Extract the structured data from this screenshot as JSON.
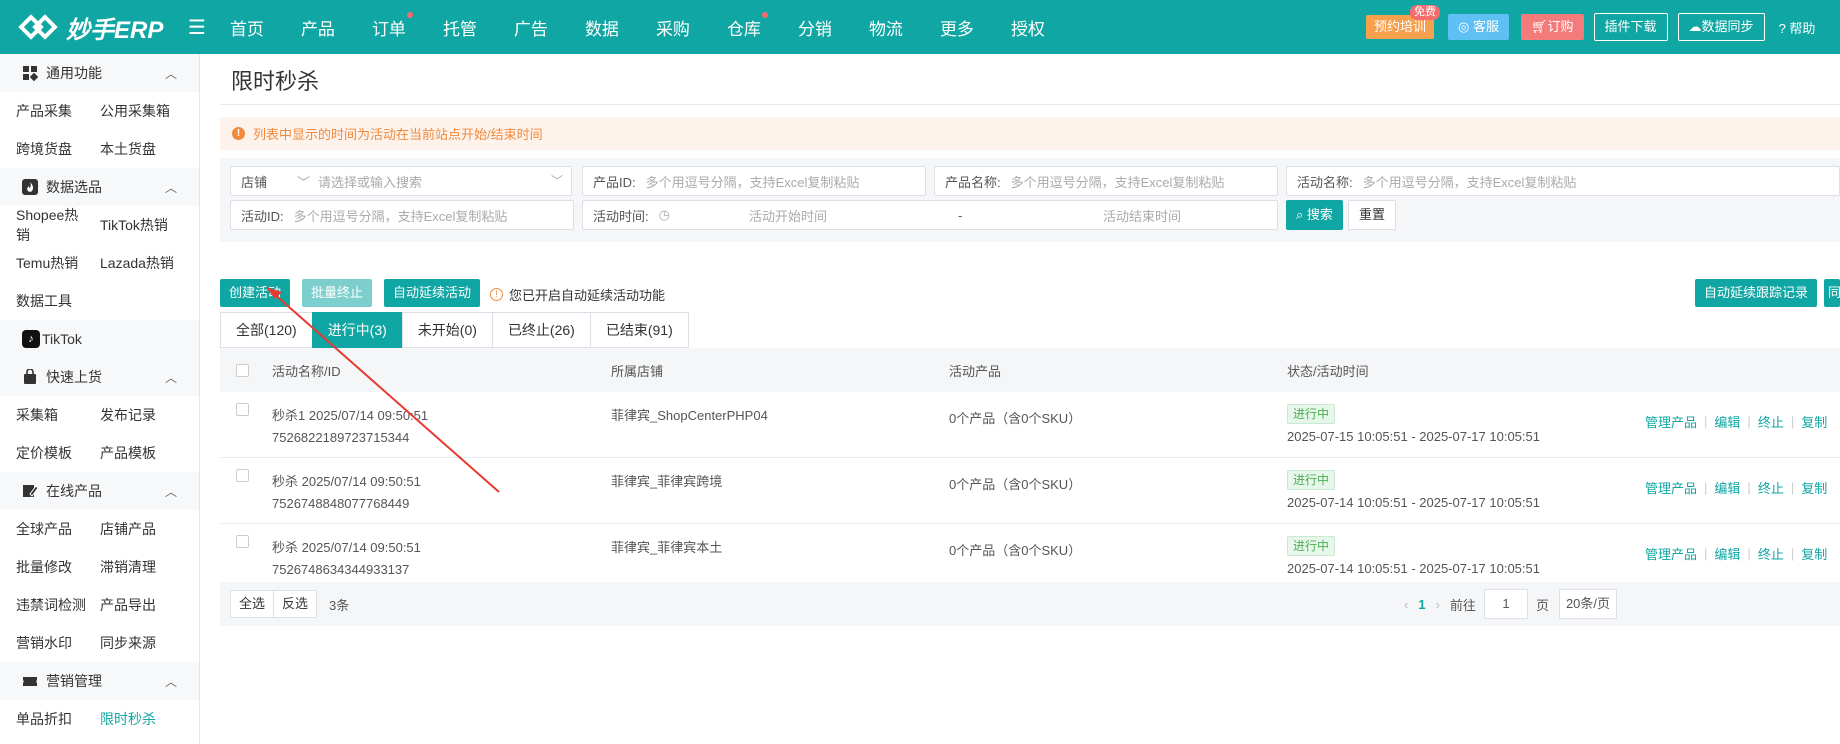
{
  "app": {
    "logo_text": "妙手ERP"
  },
  "top_nav": [
    {
      "label": "首页",
      "dot": false
    },
    {
      "label": "产品",
      "dot": false
    },
    {
      "label": "订单",
      "dot": true
    },
    {
      "label": "托管",
      "dot": false
    },
    {
      "label": "广告",
      "dot": false
    },
    {
      "label": "数据",
      "dot": false
    },
    {
      "label": "采购",
      "dot": false
    },
    {
      "label": "仓库",
      "dot": true
    },
    {
      "label": "分销",
      "dot": false
    },
    {
      "label": "物流",
      "dot": false
    },
    {
      "label": "更多",
      "dot": false
    },
    {
      "label": "授权",
      "dot": false
    }
  ],
  "top_actions": {
    "training": "预约培训",
    "training_badge": "免费",
    "service": "客服",
    "order": "订购",
    "plugin": "插件下载",
    "sync": "数据同步",
    "help": "帮助"
  },
  "sidebar": {
    "g1": "通用功能",
    "r1": [
      "产品采集",
      "公用采集箱"
    ],
    "r2": [
      "跨境货盘",
      "本土货盘"
    ],
    "g2": "数据选品",
    "r3": [
      "Shopee热销",
      "TikTok热销"
    ],
    "r4": [
      "Temu热销",
      "Lazada热销"
    ],
    "r5": "数据工具",
    "tiktok": "TikTok",
    "g3": "快速上货",
    "r6": [
      "采集箱",
      "发布记录"
    ],
    "r7": [
      "定价模板",
      "产品模板"
    ],
    "g4": "在线产品",
    "r8": [
      "全球产品",
      "店铺产品"
    ],
    "r9": [
      "批量修改",
      "滞销清理"
    ],
    "r10": [
      "违禁词检测",
      "产品导出"
    ],
    "r11": [
      "营销水印",
      "同步来源"
    ],
    "g5": "营销管理",
    "r12": [
      "单品折扣",
      "限时秒杀"
    ]
  },
  "page": {
    "title": "限时秒杀",
    "notice": "列表中显示的时间为活动在当前站点开始/结束时间"
  },
  "filters": {
    "shop_label": "店铺",
    "shop_placeholder": "请选择或输入搜索",
    "product_id_label": "产品ID:",
    "product_id_placeholder": "多个用逗号分隔，支持Excel复制粘贴",
    "product_name_label": "产品名称:",
    "product_name_placeholder": "多个用逗号分隔，支持Excel复制粘贴",
    "activity_name_label": "活动名称:",
    "activity_name_placeholder": "多个用逗号分隔，支持Excel复制粘贴",
    "activity_id_label": "活动ID:",
    "activity_id_placeholder": "多个用逗号分隔，支持Excel复制粘贴",
    "activity_time_label": "活动时间:",
    "start_placeholder": "活动开始时间",
    "range_sep": "-",
    "end_placeholder": "活动结束时间",
    "search": "搜索",
    "reset": "重置"
  },
  "toolbar": {
    "create": "创建活动",
    "batch_stop": "批量终止",
    "auto_extend": "自动延续活动",
    "auto_note": "您已开启自动延续活动功能",
    "auto_log": "自动延续跟踪记录",
    "more": "同"
  },
  "tabs": [
    {
      "label": "全部(120)",
      "active": false
    },
    {
      "label": "进行中(3)",
      "active": true
    },
    {
      "label": "未开始(0)",
      "active": false
    },
    {
      "label": "已终止(26)",
      "active": false
    },
    {
      "label": "已结束(91)",
      "active": false
    }
  ],
  "table": {
    "headers": [
      "活动名称/ID",
      "所属店铺",
      "活动产品",
      "状态/活动时间"
    ],
    "rows": [
      {
        "name": "秒杀1 2025/07/14 09:50:51",
        "id": "7526822189723715344",
        "shop": "菲律宾_ShopCenterPHP04",
        "products": "0个产品（含0个SKU）",
        "status": "进行中",
        "time": "2025-07-15 10:05:51 - 2025-07-17 10:05:51"
      },
      {
        "name": "秒杀 2025/07/14 09:50:51",
        "id": "7526748848077768449",
        "shop": "菲律宾_菲律宾跨境",
        "products": "0个产品（含0个SKU）",
        "status": "进行中",
        "time": "2025-07-14 10:05:51 - 2025-07-17 10:05:51"
      },
      {
        "name": "秒杀 2025/07/14 09:50:51",
        "id": "7526748634344933137",
        "shop": "菲律宾_菲律宾本土",
        "products": "0个产品（含0个SKU）",
        "status": "进行中",
        "time": "2025-07-14 10:05:51 - 2025-07-17 10:05:51"
      }
    ],
    "ops": [
      "管理产品",
      "编辑",
      "终止",
      "复制"
    ]
  },
  "footer": {
    "select_all": "全选",
    "invert": "反选",
    "count": "3条",
    "current_page": "1",
    "goto_label": "前往",
    "goto_value": "1",
    "page_unit": "页",
    "page_size": "20条/页"
  },
  "colors": {
    "brand": "#10a6a3",
    "annotation_arrow": "#e8392f"
  }
}
